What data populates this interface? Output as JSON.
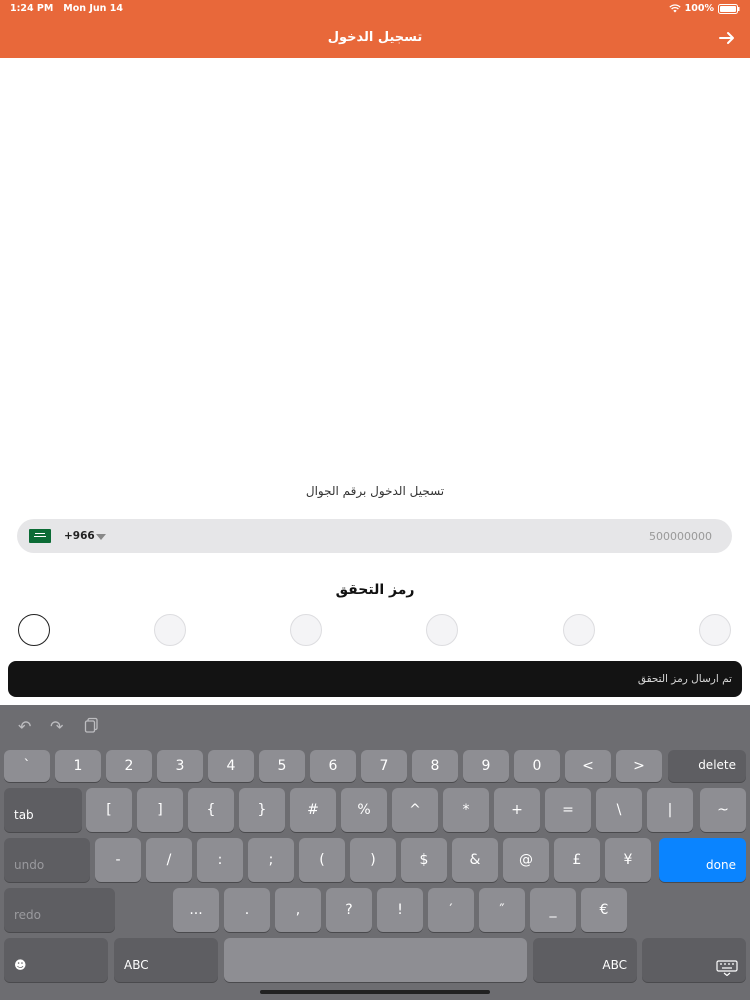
{
  "status_bar": {
    "time": "1:24 PM",
    "date": "Mon Jun 14",
    "battery": "100%"
  },
  "header": {
    "title": "تسجيل الدخول",
    "back_icon": "arrow-right-icon"
  },
  "login": {
    "phone_label": "تسجيل الدخول برقم الجوال",
    "country_code": "+966",
    "phone_placeholder": "500000000",
    "otp_title": "رمز التحقق",
    "otp_digits": 6
  },
  "toast": {
    "message": "تم ارسال رمز التحقق"
  },
  "keyboard": {
    "row1": [
      "`",
      "1",
      "2",
      "3",
      "4",
      "5",
      "6",
      "7",
      "8",
      "9",
      "0",
      "<",
      ">"
    ],
    "delete": "delete",
    "tab": "tab",
    "row2": [
      "[",
      "]",
      "{",
      "}",
      "#",
      "%",
      "^",
      "*",
      "+",
      "=",
      "\\",
      "|",
      "~"
    ],
    "undo": "undo",
    "row3": [
      "-",
      "/",
      ":",
      ";",
      "(",
      ")",
      "$",
      "&",
      "@",
      "£",
      "¥"
    ],
    "done": "done",
    "redo": "redo",
    "row4": [
      "...",
      ".",
      ",",
      "?",
      "!",
      "′",
      "″",
      "_",
      "€"
    ],
    "abc_left": "ABC",
    "abc_right": "ABC"
  }
}
